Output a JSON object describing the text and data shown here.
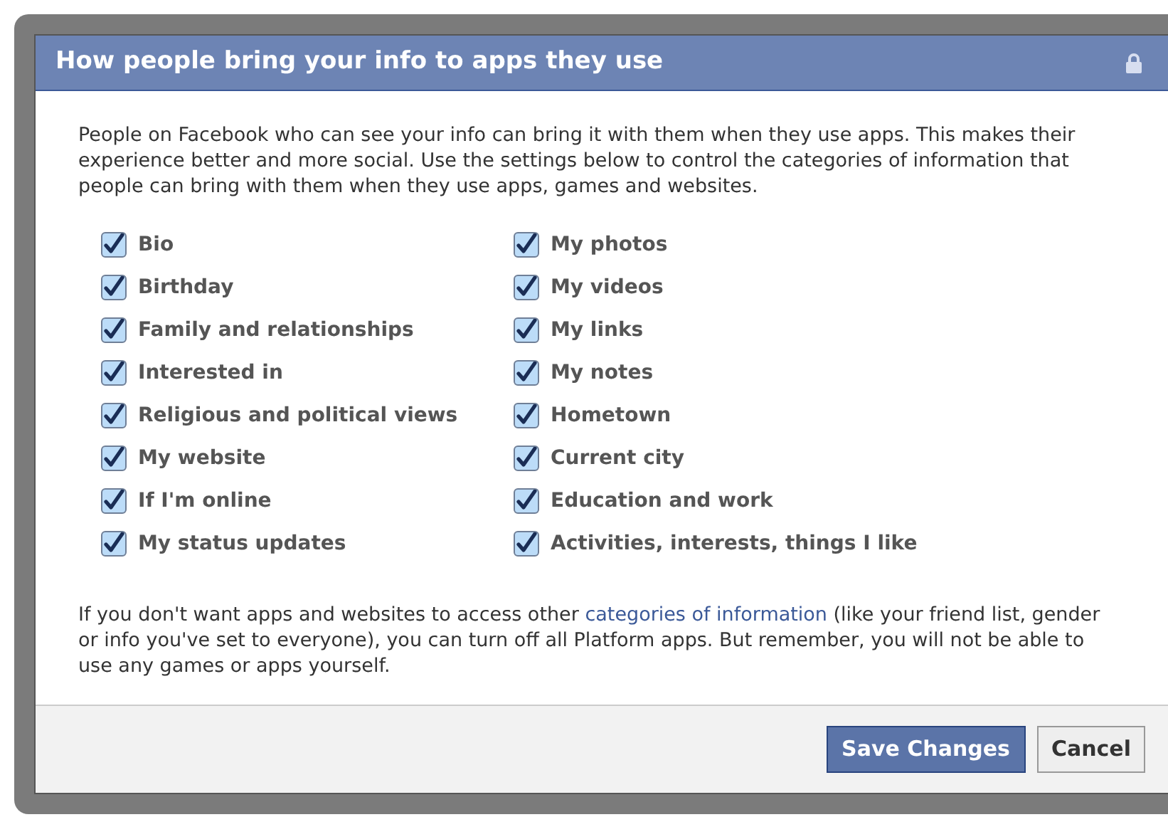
{
  "dialog": {
    "title": "How people bring your info to apps they use",
    "locked": true
  },
  "intro": "People on Facebook who can see your info can bring it with them when they use apps. This makes their experience better and more social. Use the settings below to control the categories of information that people can bring with them when they use apps, games and websites.",
  "option_columns": [
    {
      "options": [
        {
          "label": "Bio",
          "checked": true
        },
        {
          "label": "Birthday",
          "checked": true
        },
        {
          "label": "Family and relationships",
          "checked": true
        },
        {
          "label": "Interested in",
          "checked": true
        },
        {
          "label": "Religious and political views",
          "checked": true
        },
        {
          "label": "My website",
          "checked": true
        },
        {
          "label": "If I'm online",
          "checked": true
        },
        {
          "label": "My status updates",
          "checked": true
        }
      ]
    },
    {
      "options": [
        {
          "label": "My photos",
          "checked": true
        },
        {
          "label": "My videos",
          "checked": true
        },
        {
          "label": "My links",
          "checked": true
        },
        {
          "label": "My notes",
          "checked": true
        },
        {
          "label": "Hometown",
          "checked": true
        },
        {
          "label": "Current city",
          "checked": true
        },
        {
          "label": "Education and work",
          "checked": true
        },
        {
          "label": "Activities, interests, things I like",
          "checked": true
        }
      ]
    }
  ],
  "note": {
    "before": "If you don't want apps and websites to access other ",
    "link": "categories of information",
    "after": " (like your friend list, gender or info you've set to everyone), you can turn off all Platform apps. But remember, you will not be able to use any games or apps yourself."
  },
  "buttons": [
    {
      "label": "Save Changes",
      "kind": "primary"
    },
    {
      "label": "Cancel",
      "kind": "secondary"
    }
  ]
}
